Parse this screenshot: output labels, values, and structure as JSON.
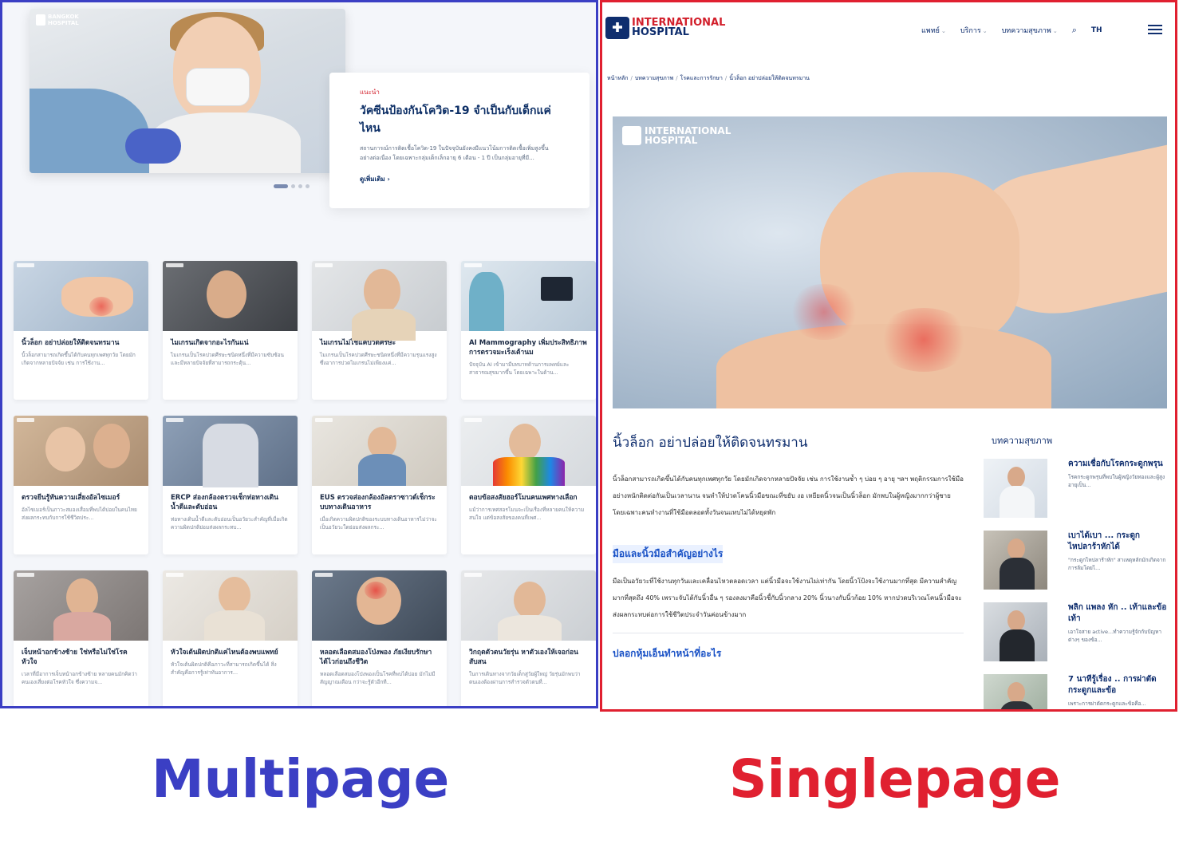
{
  "labels": {
    "multipage": "Multipage",
    "singlepage": "Singlepage"
  },
  "multipage": {
    "hero": {
      "logo_text": "BANGKOK HOSPITAL",
      "tag": "แนะนำ",
      "title": "วัคซีนป้องกันโควิด-19 จำเป็นกับเด็กแค่ไหน",
      "desc": "สถานการณ์การติดเชื้อโควิด-19 ในปัจจุบันยังคงมีแนวโน้มการติดเชื้อเพิ่มสูงขึ้นอย่างต่อเนื่อง โดยเฉพาะกลุ่มเด็กเล็กอายุ 6 เดือน - 1 ปี เป็นกลุ่มอายุที่มี...",
      "more": "ดูเพิ่มเติม"
    },
    "cards": [
      {
        "title": "นิ้วล็อก อย่าปล่อยให้ติดจนทรมาน",
        "desc": "นิ้วล็อกสามารถเกิดขึ้นได้กับคนทุกเพศทุกวัย โดยมักเกิดจากหลายปัจจัย เช่น การใช้งาน..."
      },
      {
        "title": "ไมเกรนเกิดจากอะไรกันแน่",
        "desc": "ไมเกรนเป็นโรคปวดศีรษะชนิดหนึ่งที่มีความซับซ้อนและมีหลายปัจจัยที่สามารถกระตุ้น..."
      },
      {
        "title": "ไมเกรนไม่ใช่แค่ปวดศีรษะ",
        "desc": "ไมเกรนเป็นโรคปวดศีรษะชนิดหนึ่งที่มีความรุนแรงสูง ซึ่งอาการปวดไมเกรนไม่เพียงแค่..."
      },
      {
        "title": "AI Mammography เพิ่มประสิทธิภาพการตรวจมะเร็งเต้านม",
        "desc": "ปัจจุบัน AI เข้ามามีบทบาทด้านการแพทย์และสาธารณสุขมากขึ้น โดยเฉพาะในด้าน..."
      },
      {
        "title": "ตรวจยีนรู้ทันความเสี่ยงอัลไซเมอร์",
        "desc": "อัลไซเมอร์เป็นภาวะสมองเสื่อมที่พบได้บ่อยในคนไทย ส่งผลกระทบกับการใช้ชีวิตประ..."
      },
      {
        "title": "ERCP ส่องกล้องตรวจเช็กท่อทางเดินน้ำดีและตับอ่อน",
        "desc": "ท่อทางเดินน้ำดีและตับอ่อนเป็นอวัยวะสำคัญที่เมื่อเกิดความผิดปกติย่อมส่งผลกระทบ..."
      },
      {
        "title": "EUS ตรวจส่องกล้องอัลตราซาวด์เช็กระบบทางเดินอาหาร",
        "desc": "เมื่อเกิดความผิดปกติของระบบทางเดินอาหารไม่ว่าจะเป็นอวัยวะใดย่อมส่งผลกระ..."
      },
      {
        "title": "ตอบข้อสงสัยฮอร์โมนคนเพศทางเลือก",
        "desc": "แม้ว่าการเทศสอรโมนจะเป็นเรื่องที่หลายคนให้ความสนใจ แต่ข้อสงสัยของคนที่เพศ..."
      },
      {
        "title": "เจ็บหน้าอกข้างซ้าย ใช่หรือไม่ใช่โรคหัวใจ",
        "desc": "เวลาที่มีอาการเจ็บหน้าอกข้างซ้าย หลายคนมักคิดว่าคนเองเสี่ยงต่อโรคหัวใจ ซึ่งความจ..."
      },
      {
        "title": "หัวใจเต้นผิดปกติแค่ไหนต้องพบแพทย์",
        "desc": "หัวใจเต้นผิดปกติคือภาวะที่สามารถเกิดขึ้นได้ สิ่งสำคัญคือการรู้เท่าทันอาการ..."
      },
      {
        "title": "หลอดเลือดสมองโป่งพอง ภัยเงียบรักษาได้ไวก่อนถึงชีวิต",
        "desc": "หลอดเลือดสมองโป่งพองเป็นโรคที่พบได้บ่อย มักไม่มีสัญญาณเตือน กว่าจะรู้ตัวอีกที..."
      },
      {
        "title": "วิกฤตตัวตนวัยรุ่น หาตัวเองให้เจอก่อนสับสน",
        "desc": "ในการเดินทางจากวัยเด็กสู่วัยผู้ใหญ่ วัยรุ่นมักพบว่าตนเองต้องผ่านการสำรวจตัวตนที่..."
      }
    ]
  },
  "singlepage": {
    "logo": {
      "line1": "INTERNATIONAL",
      "line2": "HOSPITAL"
    },
    "nav": [
      "แพทย์",
      "บริการ",
      "บทความสุขภาพ"
    ],
    "lang": "TH",
    "breadcrumb": [
      "หน้าหลัก",
      "บทความสุขภาพ",
      "โรคและการรักษา",
      "นิ้วล็อก อย่าปล่อยให้ติดจนทรมาน"
    ],
    "image_logo": {
      "line1": "INTERNATIONAL",
      "line2": "HOSPITAL"
    },
    "article": {
      "title": "นิ้วล็อก อย่าปล่อยให้ติดจนทรมาน",
      "p1": "นิ้วล็อกสามารถเกิดขึ้นได้กับคนทุกเพศทุกวัย โดยมักเกิดจากหลายปัจจัย เช่น การใช้งานซ้ำ ๆ บ่อย ๆ อายุ ฯลฯ พฤติกรรมการใช้มืออย่างหนักติดต่อกันเป็นเวลานาน จนทำให้ปวดโคนนิ้วมือขณะที่ขยับ งอ เหยียดนิ้วจนเป็นนิ้วล็อก มักพบในผู้หญิงมากกว่าผู้ชาย โดยเฉพาะคนทำงานที่ใช้มือตลอดทั้งวันจนแทบไม่ได้หยุดพัก",
      "h2a": "มือและนิ้วมือสำคัญอย่างไร",
      "p2": "มือเป็นอวัยวะที่ใช้งานทุกวันและเคลื่อนไหวตลอดเวลา แต่นิ้วมือจะใช้งานไม่เท่ากัน โดยนิ้วโป้งจะใช้งานมากที่สุด มีความสำคัญมากที่สุดถึง 40% เพราะจับได้กับนิ้วอื่น ๆ รองลงมาคือนิ้วชี้กับนิ้วกลาง 20% นิ้วนางกับนิ้วก้อย 10% หากปวดบริเวณโคนนิ้วมือจะส่งผลกระทบต่อการใช้ชีวิตประจำวันค่อนข้างมาก",
      "h2b": "ปลอกหุ้มเอ็นทำหน้าที่อะไร"
    },
    "aside": {
      "title": "บทความสุขภาพ",
      "items": [
        {
          "title": "ความเชื่อกับโรคกระดูกพรุน",
          "desc": "โรคกระดูกพรุนที่พบในผู้หญิงวัยทองและผู้สูงอายุเป็น..."
        },
        {
          "title": "เบาได้เบา ... กระดูกไหปลาร้าหักได้",
          "desc": "\"กระดูกไหปลาร้าหัก\" สาเหตุหลักมักเกิดจากการล้มโดยไ..."
        },
        {
          "title": "พลิก แพลง หัก .. เท้าและข้อเท้า",
          "desc": "เอาใจสาย active...ทำความรู้จักกับปัญหาต่างๆ ของข้อ..."
        },
        {
          "title": "7 นาทีรู้เรื่อง .. การผ่าตัดกระดูกและข้อ",
          "desc": "เพราะการผ่าตัดกระดูกและข้อคือ..."
        }
      ]
    }
  }
}
